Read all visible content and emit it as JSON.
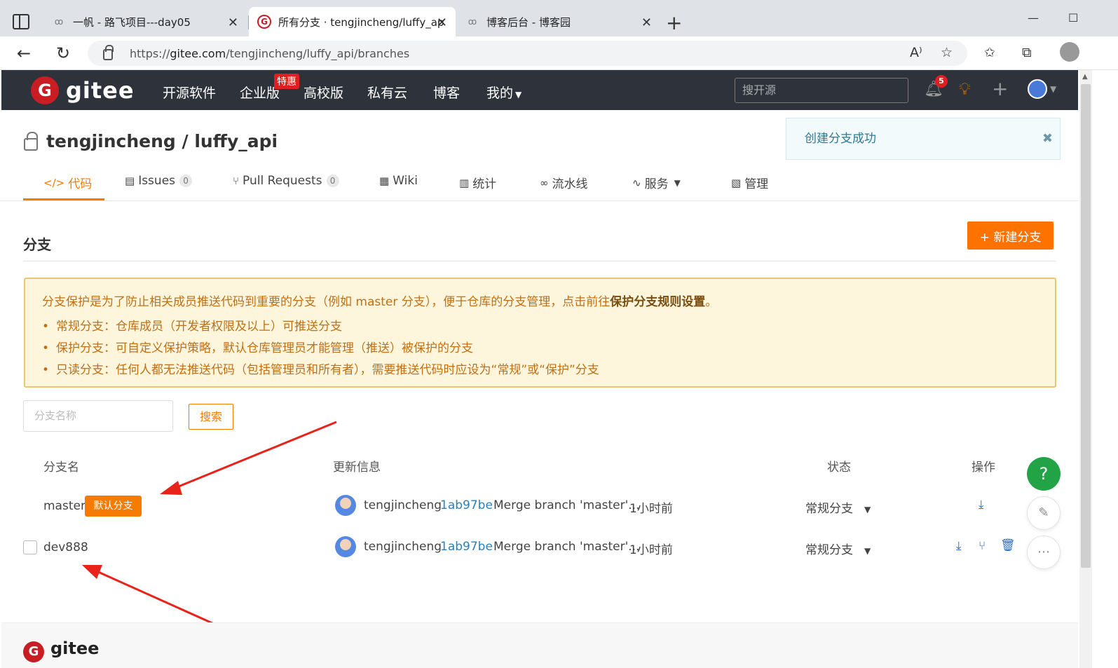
{
  "browser": {
    "tabs": [
      {
        "title": "一帆 - 路飞项目---day05",
        "favicon": "yifan-icon"
      },
      {
        "title": "所有分支 · tengjincheng/luffy_ap",
        "favicon": "gitee-icon"
      },
      {
        "title": "博客后台 - 博客园",
        "favicon": "cnblogs-icon"
      }
    ],
    "url_prefix": "https://",
    "url_host": "gitee.com",
    "url_path": "/tengjincheng/luffy_api/branches"
  },
  "gitee": {
    "logo_text": "gitee",
    "nav": [
      "开源软件",
      "企业版",
      "高校版",
      "私有云",
      "博客",
      "我的"
    ],
    "hot_badge": "特惠",
    "search_placeholder": "搜开源",
    "notifications": "5"
  },
  "repo": {
    "owner": "tengjincheng",
    "name": "luffy_api",
    "title": "tengjincheng / luffy_api",
    "tabs": [
      {
        "label": "代码",
        "icon": "code-icon",
        "active": true
      },
      {
        "label": "Issues",
        "icon": "issues-icon",
        "count": "0"
      },
      {
        "label": "Pull Requests",
        "icon": "pull-request-icon",
        "count": "0"
      },
      {
        "label": "Wiki",
        "icon": "wiki-icon"
      },
      {
        "label": "统计",
        "icon": "stats-icon"
      },
      {
        "label": "流水线",
        "icon": "pipeline-icon"
      },
      {
        "label": "服务",
        "icon": "service-icon"
      },
      {
        "label": "管理",
        "icon": "manage-icon"
      }
    ]
  },
  "toast": {
    "message": "创建分支成功",
    "close": "✖"
  },
  "branches": {
    "section_title": "分支",
    "new_button": "+ 新建分支",
    "notice": {
      "lead": "分支保护是为了防止相关成员推送代码到重要的分支（例如 master 分支），便于仓库的分支管理，点击前往",
      "lead_link": "保护分支规则设置",
      "lead_end": "。",
      "items": [
        "常规分支：仓库成员（开发者权限及以上）可推送分支",
        "保护分支：可自定义保护策略，默认仓库管理员才能管理（推送）被保护的分支",
        "只读分支：任何人都无法推送代码（包括管理员和所有者），需要推送代码时应设为“常规”或“保护”分支"
      ]
    },
    "filter_placeholder": "分支名称",
    "search_button": "搜索",
    "columns": {
      "name": "分支名",
      "update": "更新信息",
      "state": "状态",
      "ops": "操作"
    },
    "rows": [
      {
        "name": "master",
        "badge": "默认分支",
        "author": "tengjincheng",
        "hash": "1ab97be",
        "message": "Merge branch 'master'...",
        "time": "1小时前",
        "state": "常规分支"
      },
      {
        "name": "dev888",
        "author": "tengjincheng",
        "hash": "1ab97be",
        "message": "Merge branch 'master'...",
        "time": "1小时前",
        "state": "常规分支"
      }
    ]
  },
  "footer": {
    "logo_text": "gitee"
  },
  "colors": {
    "accent": "#fe7300",
    "header_bg": "#2e323b",
    "brand_red": "#c71d23",
    "link": "#2c7fb8"
  }
}
